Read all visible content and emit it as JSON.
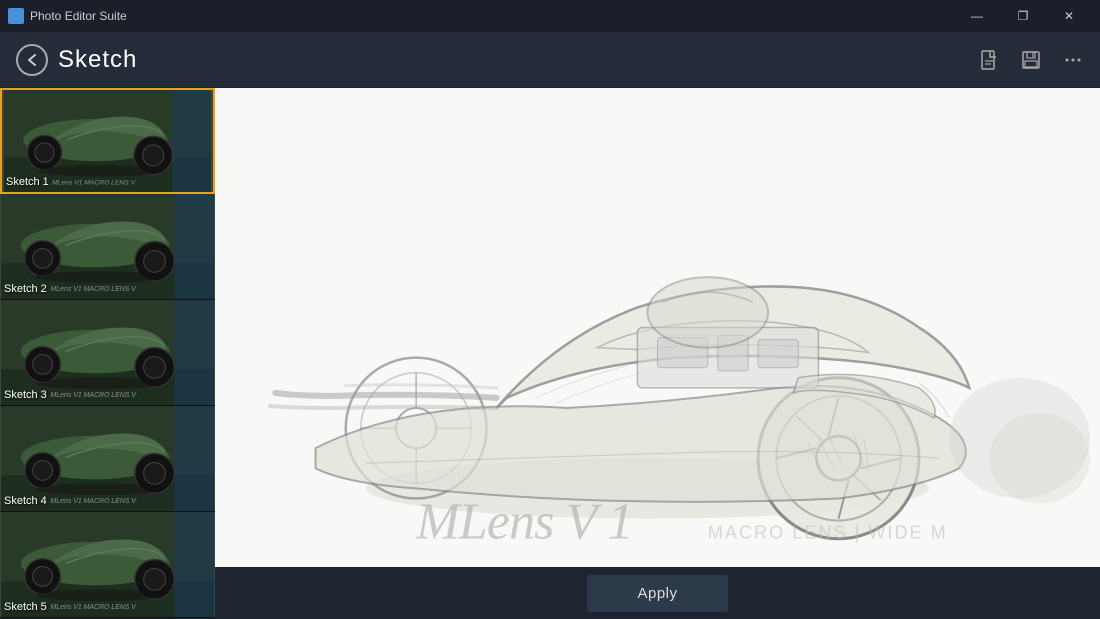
{
  "window": {
    "title": "Photo Editor Suite",
    "controls": {
      "minimize": "—",
      "maximize": "❐",
      "close": "✕"
    }
  },
  "header": {
    "back_label": "‹",
    "title": "Sketch",
    "icons": {
      "new_file": "🗋",
      "save": "💾",
      "more": "•••"
    }
  },
  "sketch_list": {
    "items": [
      {
        "id": 1,
        "label": "Sketch 1",
        "watermark": "MLens V1  MACRO LENS V",
        "active": true
      },
      {
        "id": 2,
        "label": "Sketch 2",
        "watermark": "MLens V1  MACRO LENS V",
        "active": false
      },
      {
        "id": 3,
        "label": "Sketch 3",
        "watermark": "MLens V1  MACRO LENS V",
        "active": false
      },
      {
        "id": 4,
        "label": "Sketch 4",
        "watermark": "MLens V1  MACRO LENS V",
        "active": false
      },
      {
        "id": 5,
        "label": "Sketch 5",
        "watermark": "MLens V1  MACRO LENS V",
        "active": false
      }
    ]
  },
  "preview": {
    "watermark_text": "MLens V1   MACRO LENS | WIDE M"
  },
  "apply_button": {
    "label": "Apply"
  }
}
